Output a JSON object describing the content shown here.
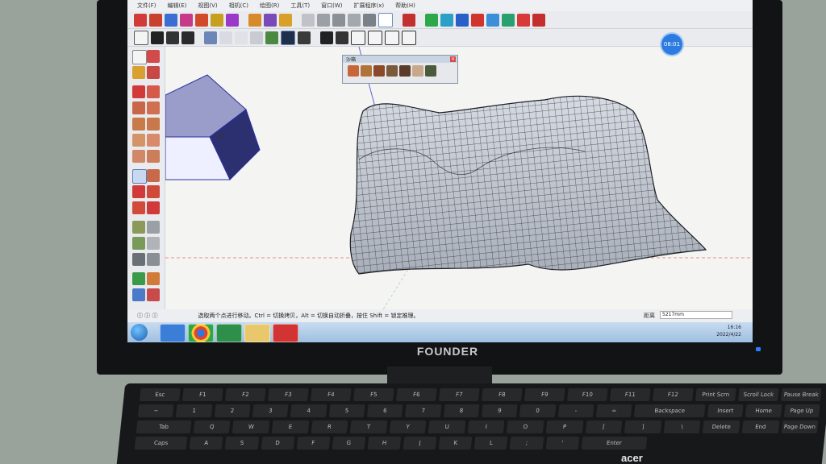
{
  "menu": [
    "文件(F)",
    "编辑(E)",
    "视图(V)",
    "相机(C)",
    "绘图(R)",
    "工具(T)",
    "窗口(W)",
    "扩展程序(x)",
    "帮助(H)"
  ],
  "floating_palette_title": "沙箱",
  "timer_badge": "08:01",
  "status_hint": "选取两个点进行移动。Ctrl = 切换拷贝，Alt = 切换自动折叠，按住 Shift = 锁定推理。",
  "measure_label": "距离",
  "measure_value": "5217mm",
  "clock_time": "16:16",
  "clock_date": "2022/4/22",
  "monitor_brand": "FOUNDER",
  "keyboard_brand": "acer",
  "keys": {
    "row1": [
      "Esc",
      "F1",
      "F2",
      "F3",
      "F4",
      "F5",
      "F6",
      "F7",
      "F8",
      "F9",
      "F10",
      "F11",
      "F12",
      "Print Scrn",
      "Scroll Lock",
      "Pause Break"
    ],
    "row2": [
      "~",
      "1",
      "2",
      "3",
      "4",
      "5",
      "6",
      "7",
      "8",
      "9",
      "0",
      "-",
      "=",
      "Backspace",
      "Insert",
      "Home",
      "Page Up"
    ],
    "row3": [
      "Tab",
      "Q",
      "W",
      "E",
      "R",
      "T",
      "Y",
      "U",
      "I",
      "O",
      "P",
      "[",
      "]",
      "\\",
      "Delete",
      "End",
      "Page Down"
    ],
    "row4": [
      "Caps",
      "A",
      "S",
      "D",
      "F",
      "G",
      "H",
      "J",
      "K",
      "L",
      ";",
      "'",
      "Enter"
    ]
  }
}
